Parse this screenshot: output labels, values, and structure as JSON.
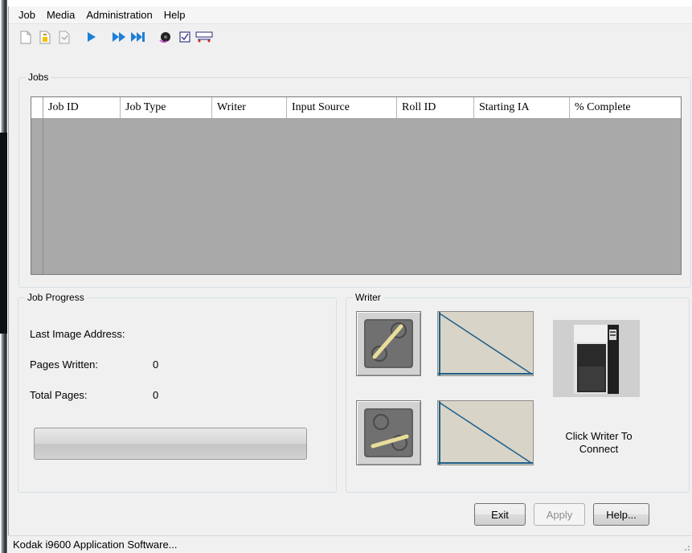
{
  "menu": {
    "items": [
      "Job",
      "Media",
      "Administration",
      "Help"
    ]
  },
  "toolbar": {
    "icons": [
      "new-job-icon",
      "open-job-icon",
      "job-properties-icon",
      "start-icon",
      "fast-forward-icon",
      "skip-to-end-icon",
      "reel-icon",
      "checklist-icon",
      "writer-settings-icon"
    ]
  },
  "jobs": {
    "title": "Jobs",
    "columns": [
      "Job ID",
      "Job Type",
      "Writer",
      "Input Source",
      "Roll ID",
      "Starting IA",
      "% Complete"
    ],
    "rows": []
  },
  "job_progress": {
    "title": "Job Progress",
    "last_image_address_label": "Last Image Address:",
    "last_image_address_value": "",
    "pages_written_label": "Pages Written:",
    "pages_written_value": "0",
    "total_pages_label": "Total Pages:",
    "total_pages_value": "0",
    "progress_fraction": 0
  },
  "writer": {
    "title": "Writer",
    "caption": "Click Writer To Connect"
  },
  "buttons": {
    "exit": "Exit",
    "apply": "Apply",
    "help": "Help..."
  },
  "status": {
    "text": "Kodak i9600 Application Software..."
  },
  "colors": {
    "grid_background": "#a9a9a9",
    "window_background": "#f0f0f0",
    "play_icon_blue": "#1e7fd6",
    "frame_line": "#1f5f8a"
  }
}
